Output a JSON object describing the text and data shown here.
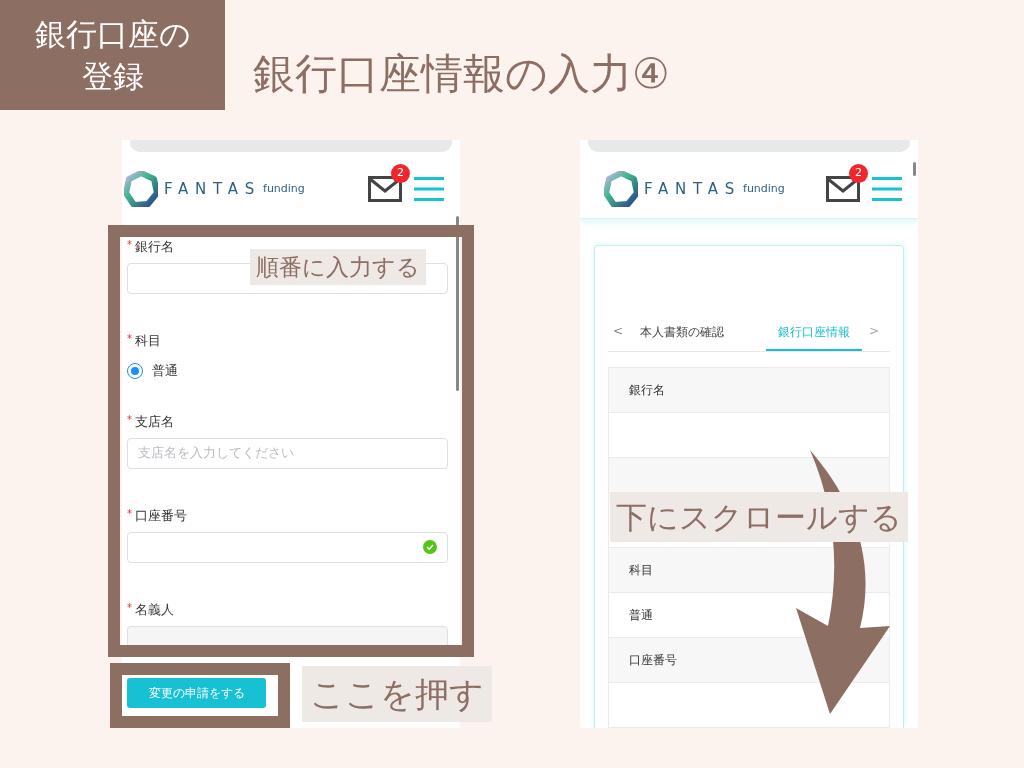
{
  "section_label": [
    "銀行口座の",
    "登録"
  ],
  "title": "銀行口座情報の入力④",
  "left_screen": {
    "logo": {
      "brand": "FANTAS",
      "sub": "funding"
    },
    "mail_badge": "2",
    "fields": [
      {
        "kind": "text",
        "marker": "*",
        "label": "銀行名",
        "valid": false
      },
      {
        "kind": "radio",
        "marker": "*",
        "label": "科目",
        "options": [
          {
            "label": "普通",
            "selected": true
          }
        ]
      },
      {
        "kind": "text",
        "marker": "*",
        "label": "支店名",
        "placeholder": "支店名を入力してください",
        "valid": false
      },
      {
        "kind": "text",
        "marker": "*",
        "label": "口座番号",
        "valid": true
      },
      {
        "kind": "readonly",
        "marker": "*",
        "label": "名義人"
      }
    ],
    "submit": "変更の申請をする"
  },
  "right_screen": {
    "logo": {
      "brand": "FANTAS",
      "sub": "funding"
    },
    "mail_badge": "2",
    "tabs": {
      "prev": "<",
      "next": ">",
      "items": [
        {
          "label": "本人書類の確認",
          "selected": false
        },
        {
          "label": "銀行口座情報",
          "selected": true
        }
      ]
    },
    "rows": [
      {
        "kind": "header",
        "text": "銀行名"
      },
      {
        "kind": "value"
      },
      {
        "kind": "header"
      },
      {
        "kind": "value"
      },
      {
        "kind": "header",
        "text": "科目"
      },
      {
        "kind": "value",
        "text": "普通"
      },
      {
        "kind": "header",
        "text": "口座番号"
      },
      {
        "kind": "value"
      }
    ]
  },
  "annotations": [
    {
      "kind": "frame-label",
      "text": "順番に入力する"
    },
    {
      "kind": "button-label",
      "text": "ここを押す"
    },
    {
      "kind": "scroll-label",
      "text": "下にスクロールする"
    }
  ]
}
